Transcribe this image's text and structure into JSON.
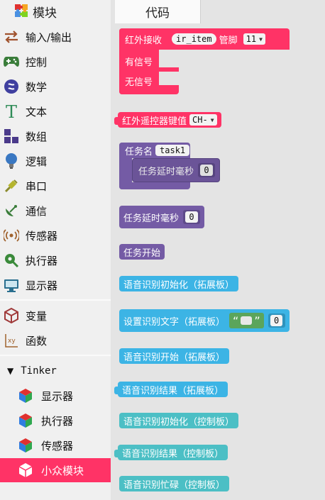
{
  "tabs": {
    "blocks_label": "模块",
    "code_label": "代码"
  },
  "toolbox": {
    "categories": [
      {
        "label": "输入/输出",
        "icon": "swap-arrows-icon"
      },
      {
        "label": "控制",
        "icon": "gamepad-icon"
      },
      {
        "label": "数学",
        "icon": "math-icon"
      },
      {
        "label": "文本",
        "icon": "text-t-icon"
      },
      {
        "label": "数组",
        "icon": "array-blocks-icon"
      },
      {
        "label": "逻辑",
        "icon": "lightbulb-icon"
      },
      {
        "label": "串口",
        "icon": "usb-plug-icon"
      },
      {
        "label": "通信",
        "icon": "satellite-dish-icon"
      },
      {
        "label": "传感器",
        "icon": "sensor-waves-icon"
      },
      {
        "label": "执行器",
        "icon": "actuator-icon"
      },
      {
        "label": "显示器",
        "icon": "monitor-icon"
      },
      {
        "label": "变量",
        "icon": "variable-cube-icon"
      },
      {
        "label": "函数",
        "icon": "function-xy-icon"
      }
    ],
    "tinker": {
      "label": "Tinker",
      "items": [
        {
          "label": "显示器",
          "icon": "color-cube-icon"
        },
        {
          "label": "执行器",
          "icon": "color-cube-icon"
        },
        {
          "label": "传感器",
          "icon": "color-cube-icon"
        },
        {
          "label": "小众模块",
          "icon": "white-cube-icon",
          "selected": true
        }
      ]
    }
  },
  "blocks": {
    "ir_receive": {
      "label": "红外接收",
      "var": "ir_item",
      "pin_label": "管脚",
      "pin_value": "11",
      "has_signal": "有信号",
      "no_signal": "无信号"
    },
    "ir_key": {
      "label": "红外遥控器键值",
      "value": "CH-"
    },
    "task": {
      "label": "任务名",
      "name": "task1",
      "inner_label": "任务延时毫秒",
      "inner_value": "0"
    },
    "task_delay": {
      "label": "任务延时毫秒",
      "value": "0"
    },
    "task_start": {
      "label": "任务开始"
    },
    "voice_init_ext": {
      "label": "语音识别初始化（拓展板）"
    },
    "voice_set_text": {
      "label": "设置识别文字（拓展板）",
      "text_open": "“",
      "text_close": "”",
      "value": "0"
    },
    "voice_start_ext": {
      "label": "语音识别开始（拓展板）"
    },
    "voice_result_ext": {
      "label": "语音识别结果（拓展板）"
    },
    "voice_init_ctrl": {
      "label": "语音识别初始化（控制板）"
    },
    "voice_result_ctrl": {
      "label": "语音识别结果（控制板）"
    },
    "voice_busy_ctrl": {
      "label": "语音识别忙碌（控制板）"
    }
  },
  "colors": {
    "ir": "#ff3366",
    "task": "#745ba5",
    "voice": "#3cb4e5",
    "voice_ctrl": "#4cbfc5",
    "text_block": "#5ba55b",
    "selected_category": "#ff3366"
  }
}
